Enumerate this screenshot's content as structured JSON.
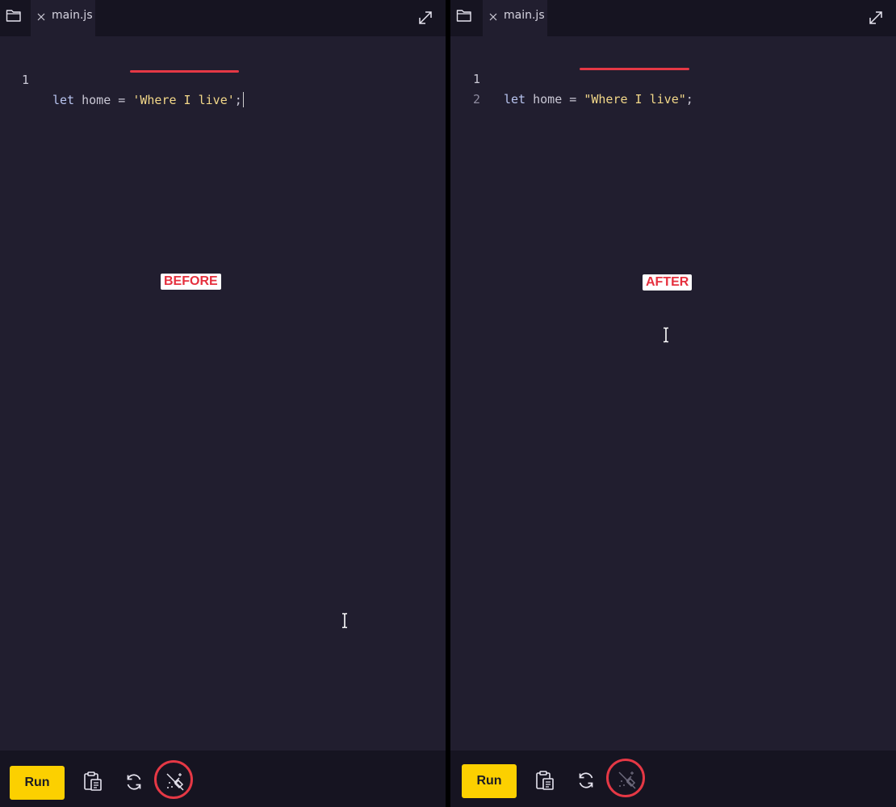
{
  "left": {
    "tab": {
      "label": "main.js"
    },
    "lines": [
      {
        "num": "1",
        "keyword": "let",
        "ident": " home ",
        "op": "=",
        "string": "'Where I live'",
        "punct": ";"
      }
    ],
    "badge": "BEFORE",
    "toolbar": {
      "run_label": "Run"
    }
  },
  "right": {
    "tab": {
      "label": "main.js"
    },
    "lines": [
      {
        "num": "1",
        "keyword": "let",
        "ident": " home ",
        "op": "=",
        "string": "\"Where I live\"",
        "punct": ";"
      },
      {
        "num": "2"
      }
    ],
    "badge": "AFTER",
    "toolbar": {
      "run_label": "Run"
    }
  },
  "colors": {
    "accent_yellow": "#fcd000",
    "highlight_red": "#e53845",
    "editor_bg": "#211e2f",
    "bar_bg": "#161421",
    "string_color": "#f3d889"
  }
}
